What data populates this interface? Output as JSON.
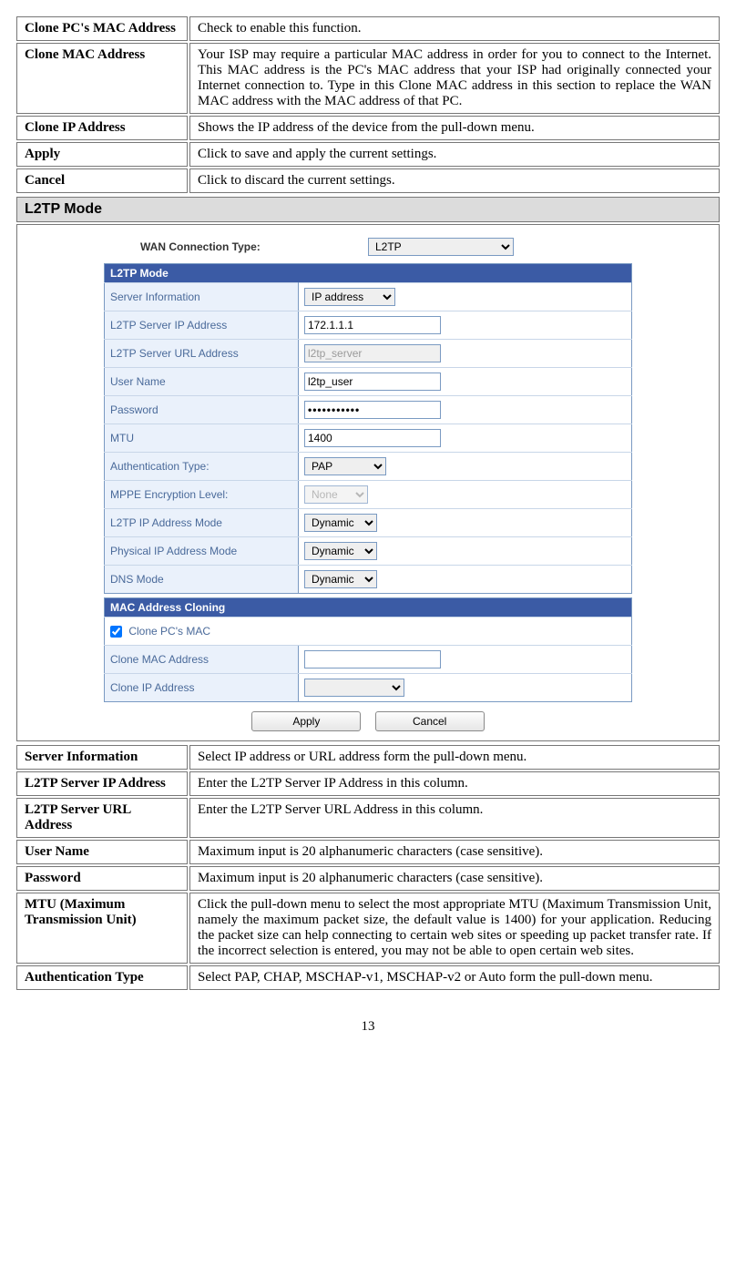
{
  "top_table": [
    {
      "key": "Clone PC's MAC Address",
      "val": "Check to enable this function."
    },
    {
      "key": "Clone MAC Address",
      "val": "Your ISP may require a particular MAC address in order for you to connect to the Internet. This MAC address is the PC's MAC address that your ISP had originally connected your Internet connection to. Type in this Clone MAC address in this section to replace the WAN MAC address with the MAC address of that PC."
    },
    {
      "key": "Clone IP Address",
      "val": "Shows the IP address of the device from the pull-down menu."
    },
    {
      "key": "Apply",
      "val": "Click to save and apply the current settings."
    },
    {
      "key": "Cancel",
      "val": "Click to discard the current settings."
    }
  ],
  "section_title": "L2TP Mode",
  "ss": {
    "wan_label": "WAN Connection Type:",
    "wan_value": "L2TP",
    "mode_header": "L2TP Mode",
    "rows": {
      "server_info_lbl": "Server Information",
      "server_info_val": "IP address",
      "l2tp_ip_lbl": "L2TP Server IP Address",
      "l2tp_ip_val": "172.1.1.1",
      "l2tp_url_lbl": "L2TP Server URL Address",
      "l2tp_url_val": "l2tp_server",
      "user_lbl": "User Name",
      "user_val": "l2tp_user",
      "pass_lbl": "Password",
      "pass_val": "•••••••••••",
      "mtu_lbl": "MTU",
      "mtu_val": "1400",
      "auth_lbl": "Authentication Type:",
      "auth_val": "PAP",
      "mppe_lbl": "MPPE Encryption Level:",
      "mppe_val": "None",
      "l2tp_mode_lbl": "L2TP IP Address Mode",
      "l2tp_mode_val": "Dynamic",
      "phys_mode_lbl": "Physical IP Address Mode",
      "phys_mode_val": "Dynamic",
      "dns_lbl": "DNS Mode",
      "dns_val": "Dynamic"
    },
    "mac_header": "MAC Address Cloning",
    "mac": {
      "clone_pc_lbl": "Clone PC's MAC",
      "clone_mac_lbl": "Clone MAC Address",
      "clone_mac_val": "",
      "clone_ip_lbl": "Clone IP Address",
      "clone_ip_val": ""
    },
    "btn_apply": "Apply",
    "btn_cancel": "Cancel"
  },
  "bottom_table": [
    {
      "key": "Server Information",
      "val": "Select IP address or URL address form the pull-down menu."
    },
    {
      "key": "L2TP Server IP Address",
      "val": "Enter the L2TP Server IP Address in this column."
    },
    {
      "key": "L2TP Server URL Address",
      "val": "Enter the L2TP Server URL Address in this column."
    },
    {
      "key": "User Name",
      "val": "Maximum input is 20 alphanumeric characters (case sensitive)."
    },
    {
      "key": "Password",
      "val": "Maximum input is 20 alphanumeric characters (case sensitive)."
    },
    {
      "key": "MTU (Maximum Transmission Unit)",
      "val": "Click the pull-down menu to select the most appropriate MTU (Maximum Transmission Unit, namely the maximum packet size, the default value is 1400) for your application. Reducing the packet size can help connecting to certain web sites or speeding up packet transfer rate. If the incorrect selection is entered, you may not be able to open certain web sites."
    },
    {
      "key": "Authentication Type",
      "val": "Select PAP, CHAP, MSCHAP-v1, MSCHAP-v2 or Auto form the pull-down menu."
    }
  ],
  "page_number": "13"
}
